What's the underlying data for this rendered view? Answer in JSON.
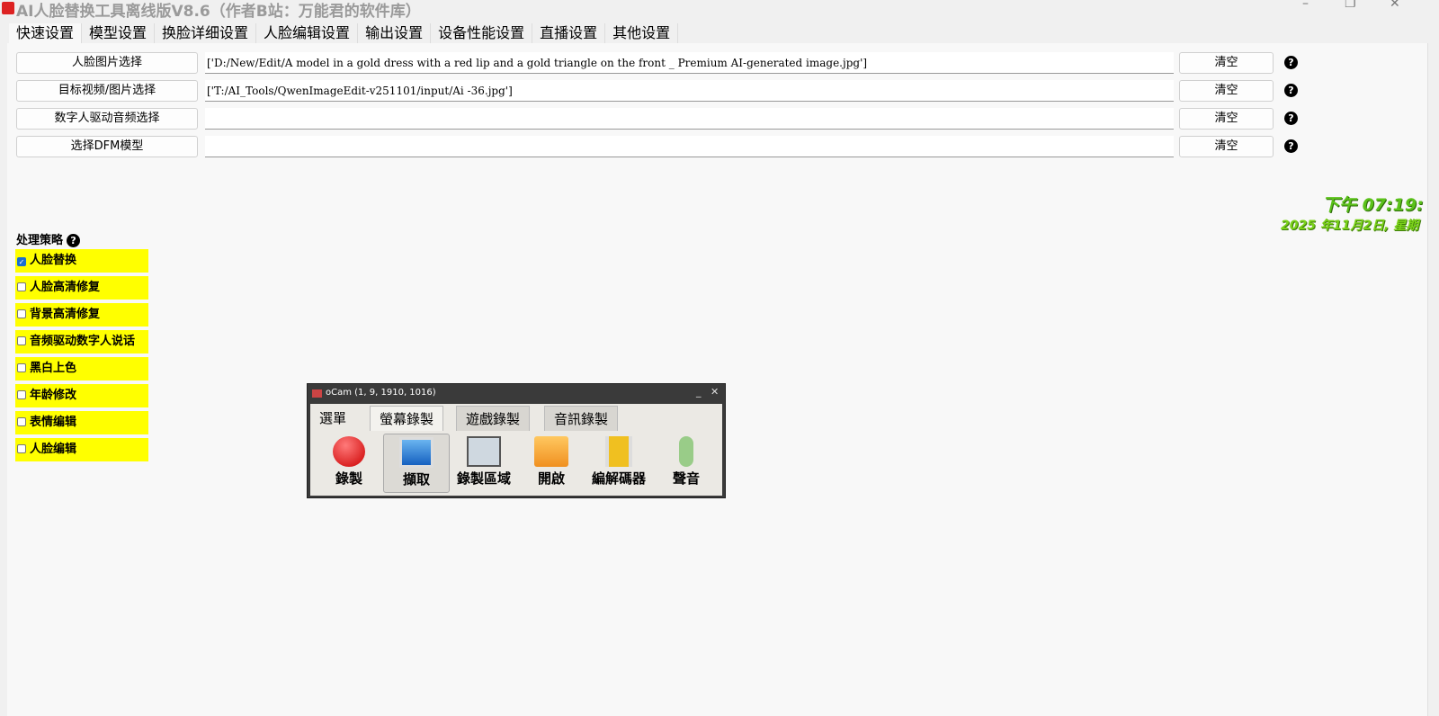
{
  "window": {
    "title": "AI人脸替换工具离线版V8.6（作者B站：万能君的软件库）",
    "minimize": "–",
    "maximize": "❐",
    "close": "✕"
  },
  "tabs": [
    "快速设置",
    "模型设置",
    "换脸详细设置",
    "人脸编辑设置",
    "输出设置",
    "设备性能设置",
    "直播设置",
    "其他设置"
  ],
  "rows": [
    {
      "button": "人脸图片选择",
      "value": "['D:/New/Edit/A model in a gold dress with a red lip and a gold triangle on the front _ Premium AI-generated image.jpg']",
      "clear": "清空",
      "help": "?"
    },
    {
      "button": "目标视频/图片选择",
      "value": "['T:/AI_Tools/QwenImageEdit-v251101/input/Ai -36.jpg']",
      "clear": "清空",
      "help": "?"
    },
    {
      "button": "数字人驱动音频选择",
      "value": "",
      "clear": "清空",
      "help": "?"
    },
    {
      "button": "选择DFM模型",
      "value": "",
      "clear": "清空",
      "help": "?"
    }
  ],
  "clock": {
    "time": "下午 07:19:",
    "date": "2025 年11月2日, 星期"
  },
  "strategy": {
    "label": "处理策略",
    "help": "?",
    "items": [
      {
        "label": "人脸替换",
        "checked": true
      },
      {
        "label": "人脸高清修复",
        "checked": false
      },
      {
        "label": "背景高清修复",
        "checked": false
      },
      {
        "label": "音频驱动数字人说话",
        "checked": false
      },
      {
        "label": "黑白上色",
        "checked": false
      },
      {
        "label": "年龄修改",
        "checked": false
      },
      {
        "label": "表情编辑",
        "checked": false
      },
      {
        "label": "人脸编辑",
        "checked": false
      }
    ]
  },
  "ocam": {
    "title": "oCam (1, 9, 1910, 1016)",
    "minimize": "_",
    "close": "✕",
    "tabs": [
      "選單",
      "螢幕錄製",
      "遊戲錄製",
      "音訊錄製"
    ],
    "tools": [
      "錄製",
      "擷取",
      "錄製區域",
      "開啟",
      "編解碼器",
      "聲音"
    ]
  }
}
